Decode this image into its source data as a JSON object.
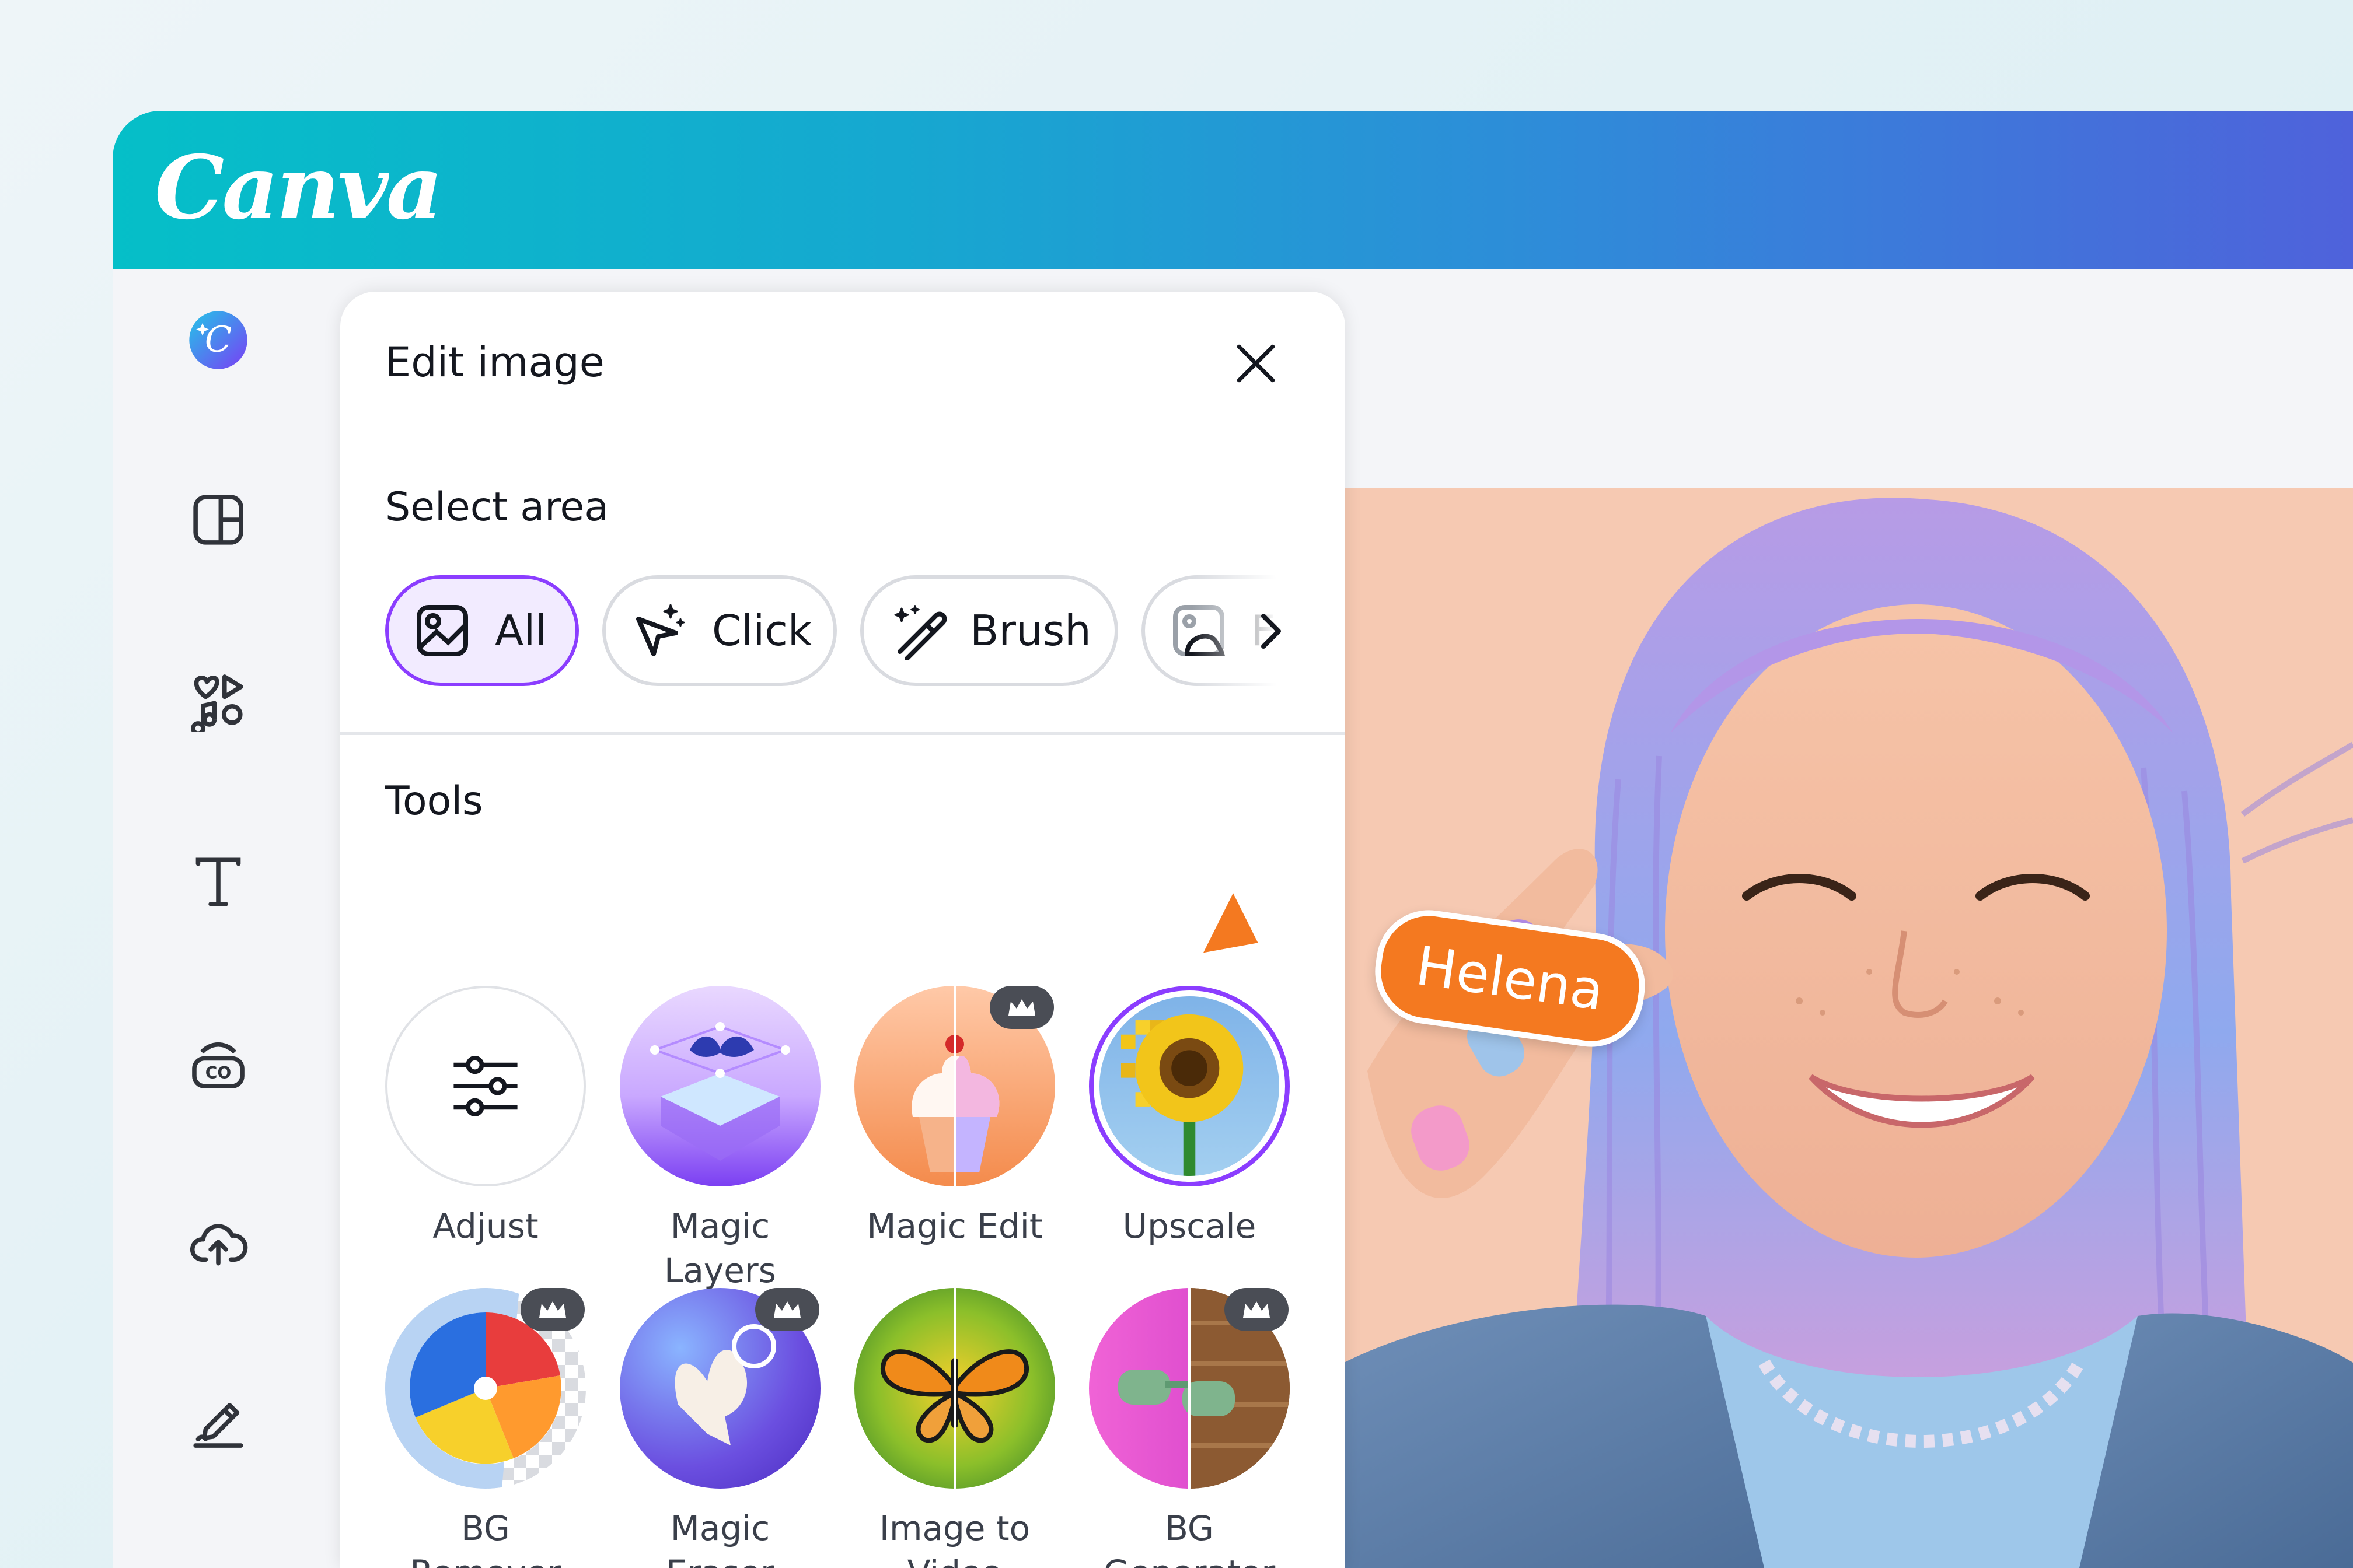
{
  "app": {
    "logo_text": "Canva",
    "brand_gradient": [
      "#05bfc8",
      "#4f62db"
    ],
    "accent": "#8b3dff"
  },
  "rail": {
    "items": [
      {
        "name": "canva-ai-icon"
      },
      {
        "name": "templates-icon"
      },
      {
        "name": "elements-icon"
      },
      {
        "name": "text-icon"
      },
      {
        "name": "brand-icon"
      },
      {
        "name": "uploads-icon"
      },
      {
        "name": "draw-icon"
      }
    ]
  },
  "panel": {
    "title": "Edit image",
    "close_icon": "close-icon",
    "select_area": {
      "title": "Select area",
      "options": [
        {
          "label": "All",
          "icon": "image-icon",
          "active": true
        },
        {
          "label": "Click",
          "icon": "cursor-sparkle-icon",
          "active": false
        },
        {
          "label": "Brush",
          "icon": "magic-brush-icon",
          "active": false
        },
        {
          "label": "Fo",
          "icon": "image-foreground-icon",
          "active": false
        }
      ]
    },
    "tools": {
      "title": "Tools",
      "items": [
        {
          "label": "Adjust",
          "premium": false
        },
        {
          "label": "Magic Layers",
          "premium": false
        },
        {
          "label": "Magic Edit",
          "premium": true
        },
        {
          "label": "Upscale",
          "premium": false
        },
        {
          "label": "BG Remover",
          "premium": true
        },
        {
          "label": "Magic Eraser",
          "premium": true
        },
        {
          "label": "Image to Video",
          "premium": false
        },
        {
          "label": "BG Generator",
          "premium": true
        }
      ]
    }
  },
  "collaborator": {
    "name": "Helena",
    "color": "#f47920"
  }
}
